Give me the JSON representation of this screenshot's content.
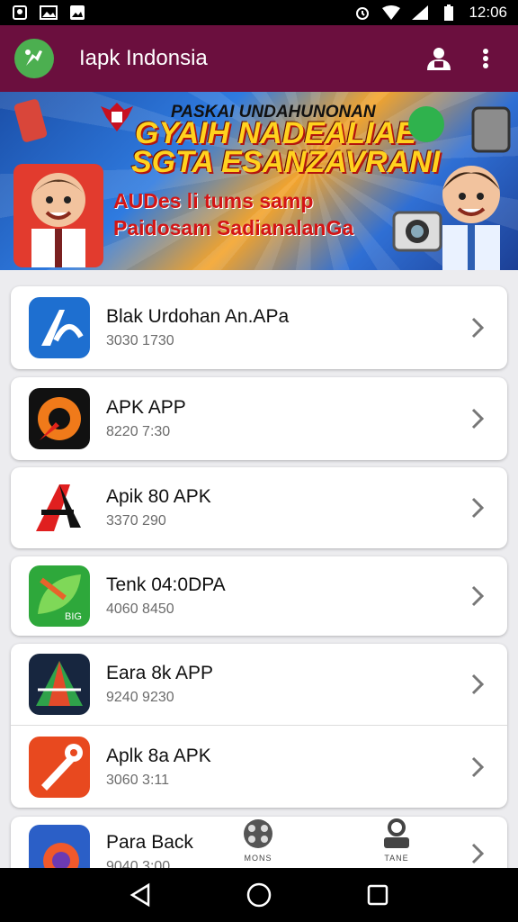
{
  "status_bar": {
    "time": "12:06",
    "left_icons": [
      "notification-icon",
      "image-icon",
      "image-icon"
    ],
    "right_icons": [
      "alarm-icon",
      "wifi-icon",
      "signal-icon",
      "battery-icon"
    ]
  },
  "app_bar": {
    "title": "Iapk Indonsia",
    "actions": [
      "account-icon",
      "more-vert-icon"
    ]
  },
  "banner": {
    "heading": "PASKAI UNDAHUNONAN",
    "headline1": "GYAIH NADEALIAE",
    "headline2": "SGTA ESANZAVRANI",
    "line1": "AUDes li tums samp",
    "line2": "Paidosam SadianalanGa"
  },
  "apps": [
    {
      "name": "Blak Urdohan An.APa",
      "meta": "3030 1730",
      "icon": "blue-a-icon"
    },
    {
      "name": "APK APP",
      "meta": "8220 7:30",
      "icon": "rocket-icon"
    },
    {
      "name": "Apik 80 APK",
      "meta": "3370 290",
      "icon": "red-a-icon"
    },
    {
      "name": "Tenk 04:0DPA",
      "meta": "4060 8450",
      "icon": "green-leaf-icon"
    },
    {
      "name": "Eara 8k APP",
      "meta": "9240 9230",
      "icon": "dark-triangle-icon"
    },
    {
      "name": "Aplk 8a APK",
      "meta": "3060 3:11",
      "icon": "tools-icon"
    },
    {
      "name": "Para Back",
      "meta": "9040 3:00",
      "icon": "circle-icon"
    }
  ],
  "bottom_tabs": [
    {
      "label": "MONS",
      "icon": "globe-icon"
    },
    {
      "label": "TANE",
      "icon": "person-icon"
    }
  ],
  "nav_bar": [
    "back-icon",
    "home-icon",
    "recents-icon"
  ],
  "colors": {
    "app_bar": "#6b0f3e",
    "logo": "#4caf50",
    "background": "#ececef"
  }
}
